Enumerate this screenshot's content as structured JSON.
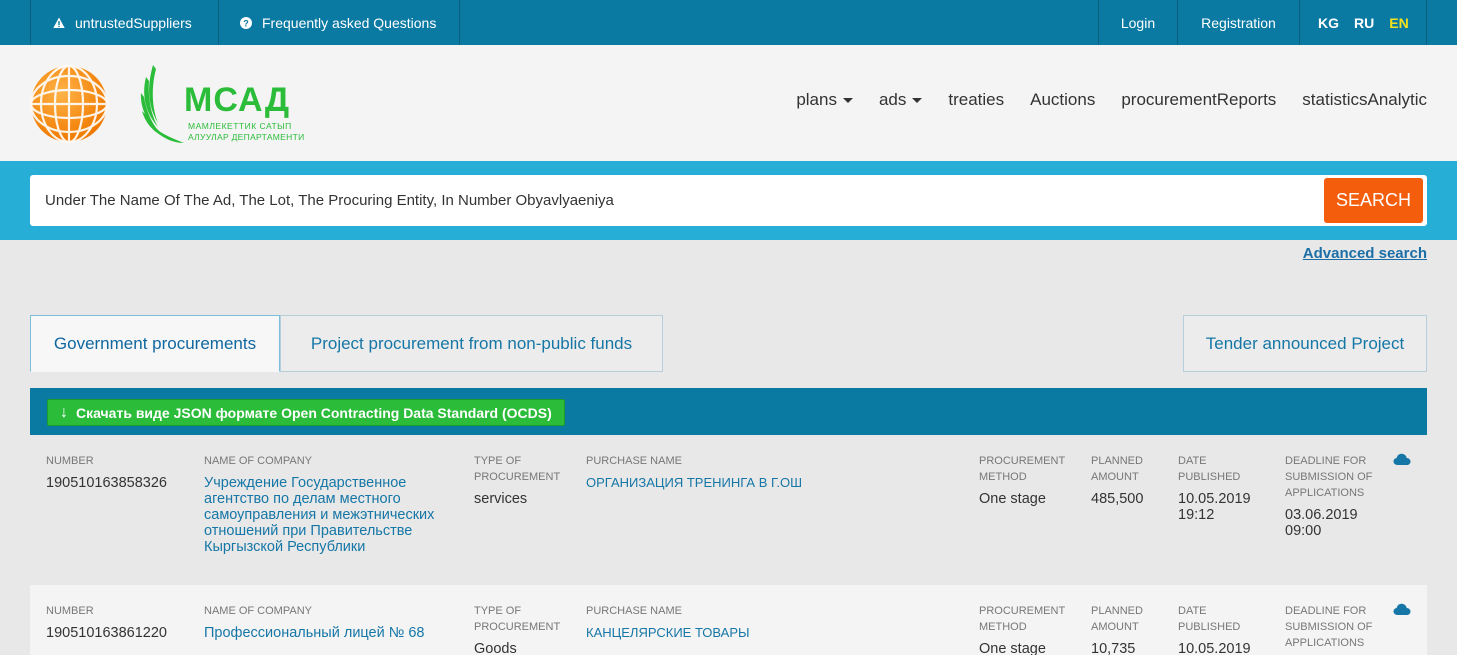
{
  "topbar": {
    "untrusted": "untrustedSuppliers",
    "faq": "Frequently asked Questions",
    "login": "Login",
    "registration": "Registration",
    "langs": [
      "KG",
      "RU",
      "EN"
    ],
    "active_lang": "EN"
  },
  "logo": {
    "title": "МСАД",
    "sub1": "МАМЛЕКЕТТИК САТЫП",
    "sub2": "АЛУУЛАР ДЕПАРТАМЕНТИ"
  },
  "nav": {
    "plans": "plans",
    "ads": "ads",
    "treaties": "treaties",
    "auctions": "Auctions",
    "reports": "procurementReports",
    "stats": "statisticsAnalytic"
  },
  "search": {
    "placeholder": "Under The Name Of The Ad, The Lot, The Procuring Entity, In Number Obyavlyaeniya",
    "button": "SEARCH",
    "advanced": "Advanced search"
  },
  "tabs": {
    "gov": "Government procurements",
    "project": "Project procurement from non-public funds",
    "tender": "Tender announced Project"
  },
  "download_label": "Скачать виде JSON формате Open Contracting Data Standard (OCDS)",
  "labels": {
    "number": "NUMBER",
    "company": "NAME OF COMPANY",
    "type": "TYPE OF PROCUREMENT",
    "purchase": "PURCHASE NAME",
    "method": "PROCUREMENT METHOD",
    "amount": "PLANNED AMOUNT",
    "date": "DATE PUBLISHED",
    "deadline": "DEADLINE FOR SUBMISSION OF APPLICATIONS"
  },
  "rows": [
    {
      "number": "190510163858326",
      "company": "Учреждение Государственное агентство по делам местного самоуправления и межэтнических отношений при Правительстве Кыргызской Республики",
      "type": "services",
      "purchase": "ОРГАНИЗАЦИЯ ТРЕНИНГА В Г.ОШ",
      "method": "One stage",
      "amount": "485,500",
      "date": "10.05.2019 19:12",
      "deadline": "03.06.2019 09:00"
    },
    {
      "number": "190510163861220",
      "company": "Профессиональный лицей № 68",
      "type": "Goods",
      "purchase": "КАНЦЕЛЯРСКИЕ ТОВАРЫ",
      "method": "One stage",
      "amount": "10,735",
      "date": "10.05.2019",
      "deadline": ""
    }
  ],
  "colors": {
    "topbar": "#0a7aa3",
    "search_band": "#27aed6",
    "search_button": "#f45d0c",
    "download_button": "#2bbd3a",
    "link": "#1677a7",
    "active_lang": "#f3e21b"
  }
}
